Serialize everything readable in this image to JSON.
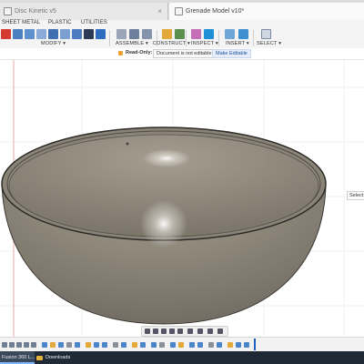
{
  "tabs": [
    {
      "title": "Disc Kinetic v5",
      "close": "×"
    },
    {
      "title": "Grenade Model v10*",
      "close": ""
    }
  ],
  "menu": [
    "SHEET METAL",
    "PLASTIC",
    "UTILITIES"
  ],
  "toolbar_groups": [
    "MODIFY ▾",
    "ASSEMBLE ▾",
    "CONSTRUCT ▾",
    "INSPECT ▾",
    "INSERT ▾",
    "SELECT ▾"
  ],
  "readonly_bar": {
    "label": "Read-Only:",
    "message": "Document is not editable",
    "button": "Make Editable"
  },
  "viewport": {
    "selection_tip": "Select o"
  },
  "taskbar": {
    "fusion": "Fusion 360 L...",
    "downloads": "Downloads"
  },
  "colors": {
    "accent": "#1f5fbf",
    "bowl_body": "#8a8377",
    "bowl_rim": "#4d4a44",
    "taskbar": "#1f2a36"
  }
}
